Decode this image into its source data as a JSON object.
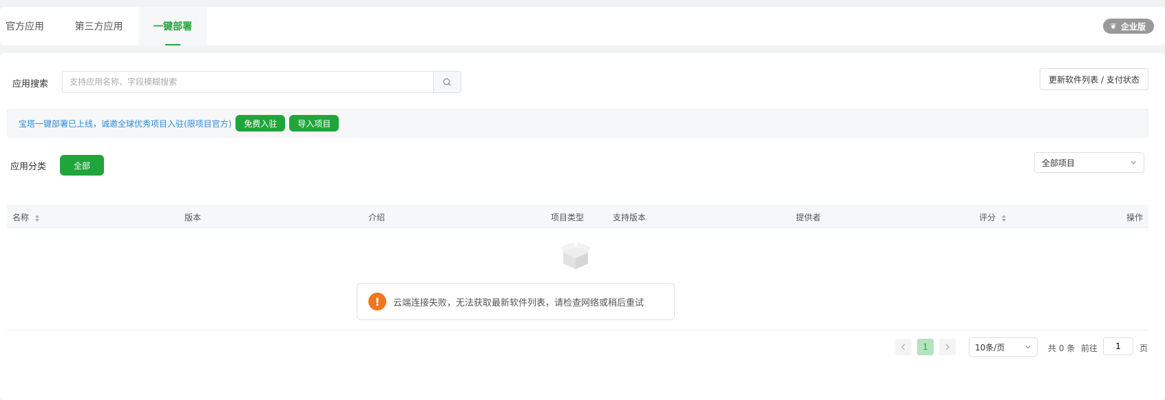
{
  "tabs": [
    {
      "label": "官方应用"
    },
    {
      "label": "第三方应用"
    },
    {
      "label": "一键部署"
    }
  ],
  "header": {
    "enterprise_badge": "企业版"
  },
  "search": {
    "label": "应用搜索",
    "placeholder": "支持应用名称、字段模糊搜索",
    "value": ""
  },
  "toolbar": {
    "update_label": "更新软件列表 / 支付状态"
  },
  "notice": {
    "text": "宝塔一键部署已上线，诚邀全球优秀项目入驻(限项目官方)",
    "free_join_label": "免费入驻",
    "import_label": "导入项目"
  },
  "category": {
    "label": "应用分类",
    "all_label": "全部",
    "filter_selected": "全部项目"
  },
  "table": {
    "columns": [
      "名称",
      "版本",
      "介绍",
      "项目类型",
      "支持版本",
      "提供者",
      "评分",
      "操作"
    ]
  },
  "empty": {
    "message": "云端连接失败，无法获取最新软件列表，请检查网络或稍后重试"
  },
  "pagination": {
    "current_page": "1",
    "page_size": "10条/页",
    "total": "共 0 条",
    "goto_label": "前往",
    "goto_value": "1",
    "page_suffix": "页"
  },
  "colors": {
    "accent": "#20a53a",
    "notice_text": "#2e8bd8",
    "warning": "#f0761e"
  }
}
